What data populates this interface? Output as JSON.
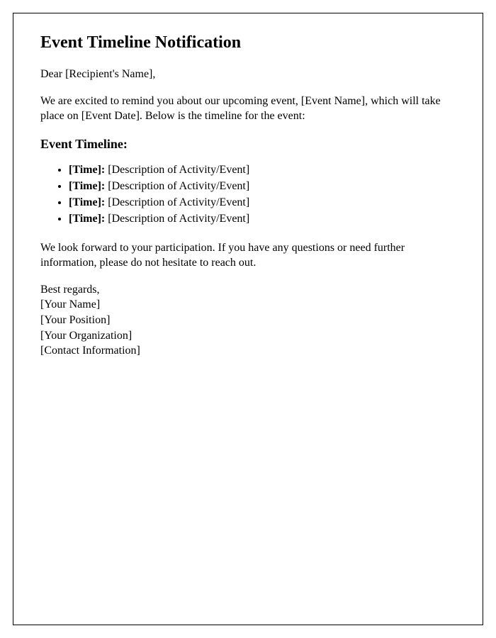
{
  "heading": "Event Timeline Notification",
  "greeting": "Dear [Recipient's Name],",
  "intro": "We are excited to remind you about our upcoming event, [Event Name], which will take place on [Event Date]. Below is the timeline for the event:",
  "timeline_heading": "Event Timeline:",
  "timeline_items": [
    {
      "time": "[Time]:",
      "desc": " [Description of Activity/Event]"
    },
    {
      "time": "[Time]:",
      "desc": " [Description of Activity/Event]"
    },
    {
      "time": "[Time]:",
      "desc": " [Description of Activity/Event]"
    },
    {
      "time": "[Time]:",
      "desc": " [Description of Activity/Event]"
    }
  ],
  "closing_paragraph": "We look forward to your participation. If you have any questions or need further information, please do not hesitate to reach out.",
  "signoff_regards": "Best regards,",
  "signoff_name": "[Your Name]",
  "signoff_position": "[Your Position]",
  "signoff_org": "[Your Organization]",
  "signoff_contact": "[Contact Information]"
}
